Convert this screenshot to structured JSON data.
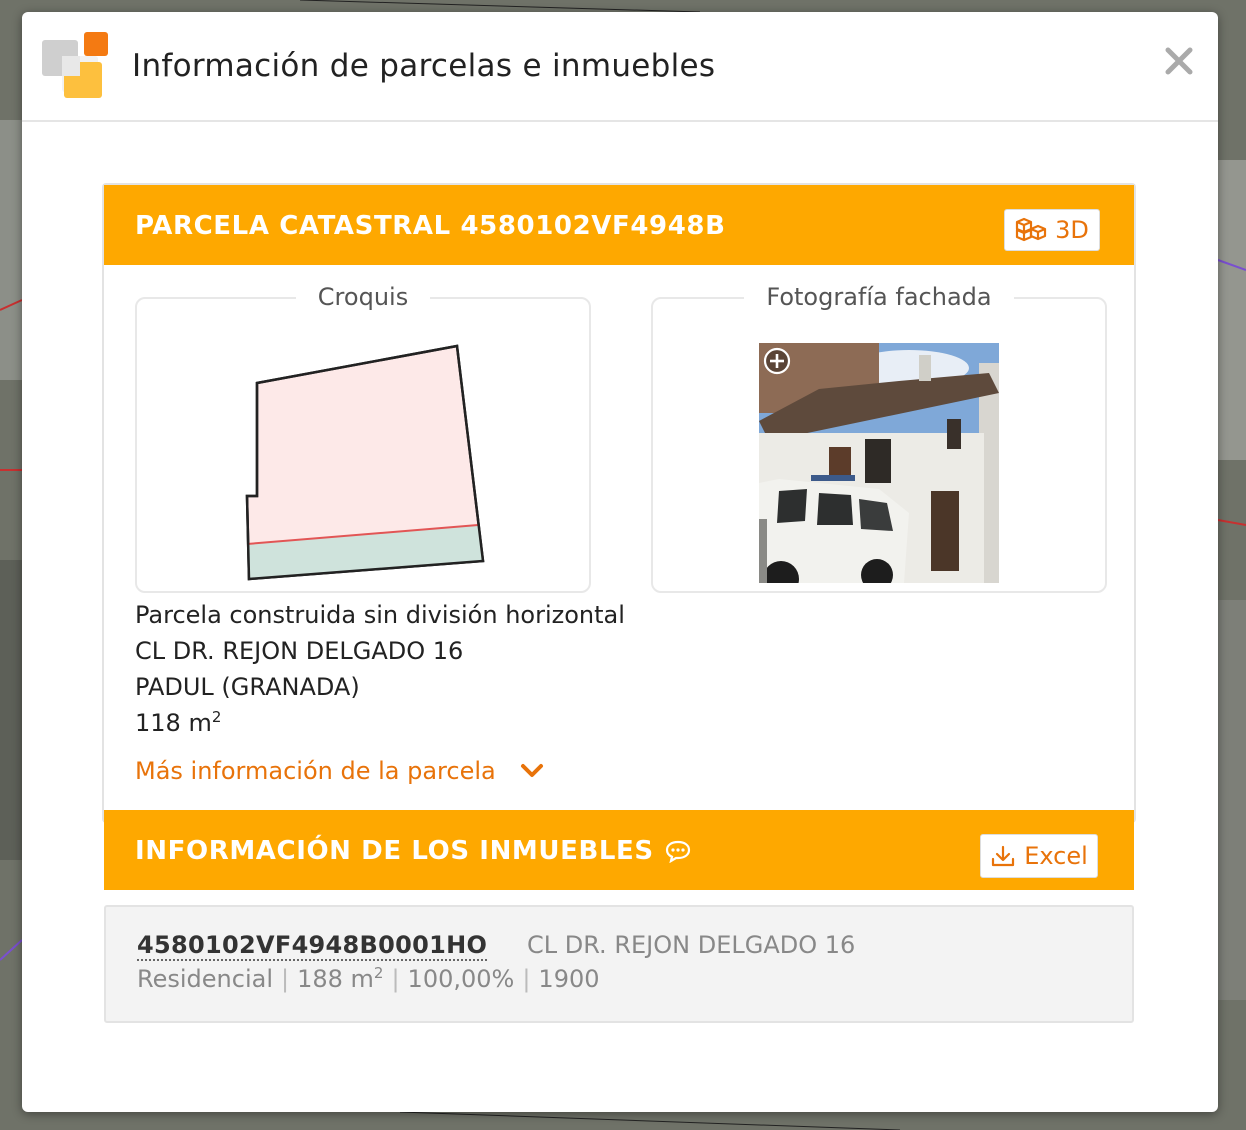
{
  "modal": {
    "title": "Información de parcelas e inmuebles"
  },
  "parcel": {
    "header": "PARCELA CATASTRAL 4580102VF4948B",
    "btn_3d": "3D",
    "croquis_label": "Croquis",
    "photo_label": "Fotografía fachada",
    "type": "Parcela construida sin división horizontal",
    "address": "CL DR. REJON DELGADO 16",
    "municipality": "PADUL (GRANADA)",
    "area_value": "118 m",
    "area_exp": "2",
    "more_info": "Más información de la parcela"
  },
  "units": {
    "header": "INFORMACIÓN DE LOS INMUEBLES",
    "excel_label": "Excel",
    "items": [
      {
        "reference": "4580102VF4948B0001HO",
        "address": "CL DR. REJON DELGADO 16",
        "use": "Residencial",
        "area": "188 m",
        "area_exp": "2",
        "participation": "100,00%",
        "year": "1900"
      }
    ]
  },
  "colors": {
    "accent_orange": "#fea800",
    "link_orange": "#e8730a"
  }
}
